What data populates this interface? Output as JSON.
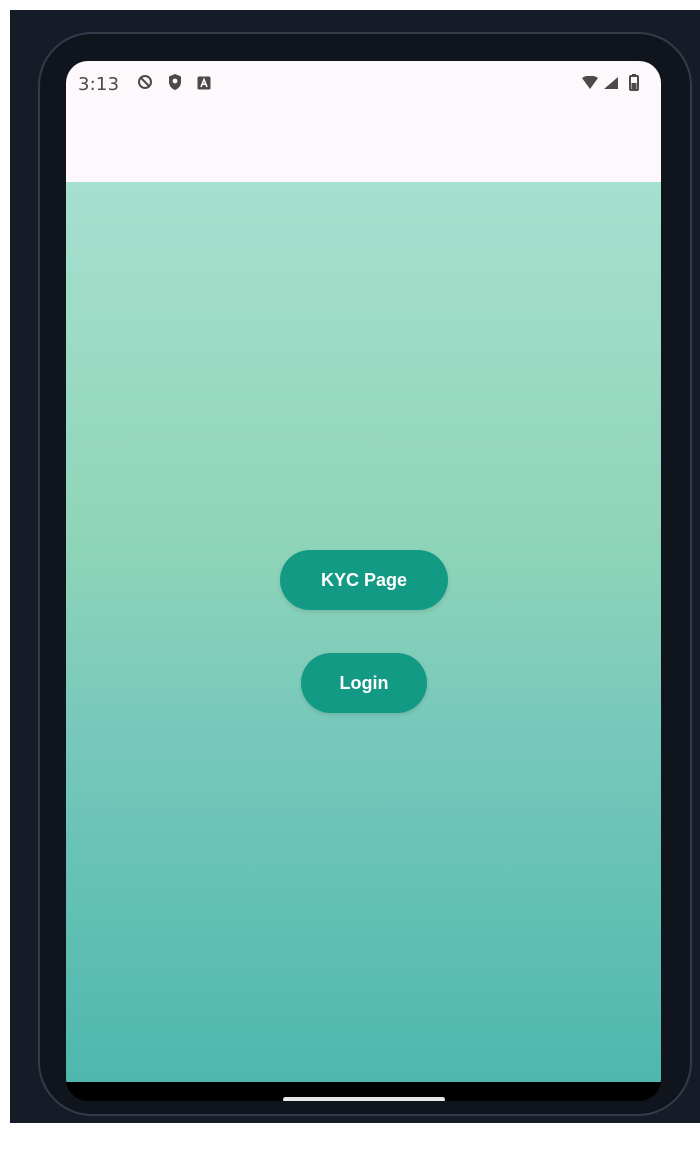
{
  "status_bar": {
    "time": "3:13",
    "left_icons": [
      "do-not-disturb-icon",
      "shield-icon",
      "notification-a-icon"
    ],
    "right_icons": [
      "wifi-icon",
      "cellular-signal-icon",
      "battery-icon"
    ]
  },
  "app_bar": {
    "title": ""
  },
  "main": {
    "kyc_button_label": "KYC Page",
    "login_button_label": "Login"
  },
  "colors": {
    "button": "#129a84",
    "gradient_top": "#a6e0cf",
    "gradient_bottom": "#4fb7ae",
    "status_bar_bg": "#fcf8fb"
  }
}
